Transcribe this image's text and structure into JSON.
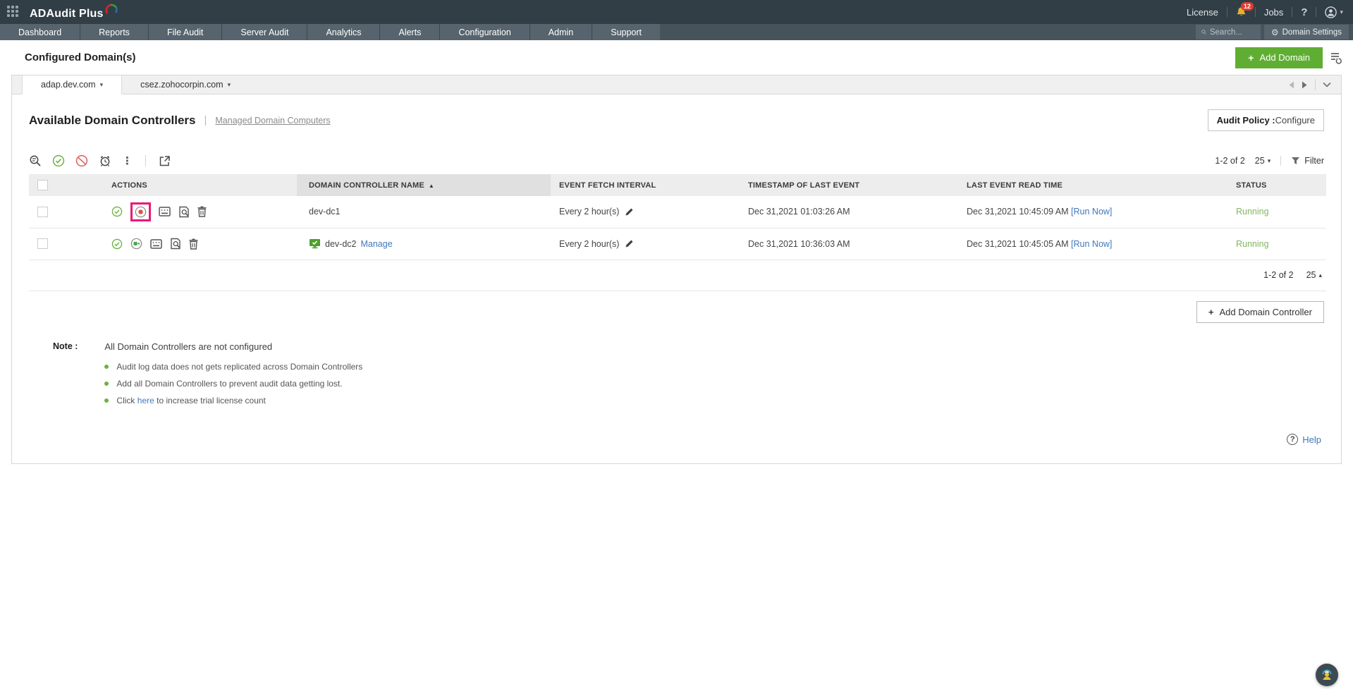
{
  "header": {
    "product_name": "ADAudit Plus",
    "license": "License",
    "notification_count": "12",
    "jobs": "Jobs",
    "help_symbol": "?"
  },
  "nav": {
    "tabs": [
      "Dashboard",
      "Reports",
      "File Audit",
      "Server Audit",
      "Analytics",
      "Alerts",
      "Configuration",
      "Admin",
      "Support"
    ],
    "search_placeholder": "Search...",
    "domain_settings": "Domain Settings"
  },
  "page": {
    "title": "Configured Domain(s)",
    "add_domain_button": "Add Domain"
  },
  "domain_tabs": {
    "active": "adap.dev.com",
    "second": "csez.zohocorpin.com"
  },
  "section": {
    "title": "Available Domain Controllers",
    "managed_link": "Managed Domain Computers",
    "audit_policy_bold": "Audit Policy :",
    "audit_policy_action": "Configure"
  },
  "toolbar": {
    "range": "1-2 of 2",
    "page_size": "25",
    "filter_label": "Filter"
  },
  "table": {
    "headers": {
      "actions": "ACTIONS",
      "dc_name": "DOMAIN CONTROLLER NAME",
      "fetch_interval": "EVENT FETCH INTERVAL",
      "last_event": "TIMESTAMP OF LAST EVENT",
      "last_read": "LAST EVENT READ TIME",
      "status": "STATUS"
    },
    "rows": [
      {
        "name": "dev-dc1",
        "interval": "Every 2 hour(s)",
        "last_event": "Dec 31,2021 01:03:26 AM",
        "last_read": "Dec 31,2021 10:45:09 AM",
        "run_now": "[Run Now]",
        "status": "Running"
      },
      {
        "name": "dev-dc2",
        "manage": "Manage",
        "interval": "Every 2 hour(s)",
        "last_event": "Dec 31,2021 10:36:03 AM",
        "last_read": "Dec 31,2021 10:45:05 AM",
        "run_now": "[Run Now]",
        "status": "Running"
      }
    ],
    "footer_range": "1-2 of 2",
    "footer_page_size": "25"
  },
  "add_dc_button": "Add Domain Controller",
  "note": {
    "label": "Note :",
    "title": "All Domain Controllers are not configured",
    "bullets": [
      {
        "text": "Audit log data does not gets replicated across Domain Controllers"
      },
      {
        "text": "Add all Domain Controllers to prevent audit data getting lost."
      },
      {
        "prefix": "Click ",
        "link": "here",
        "suffix": " to increase trial license count"
      }
    ]
  },
  "help_label": "Help",
  "icons": {
    "plus": "+",
    "caret_down": "▾",
    "caret_up": "▴",
    "sort_asc": "▲",
    "kebab": "⋮",
    "gear": "⚙"
  },
  "colors": {
    "accent_green": "#5fae33",
    "link_blue": "#4077bc",
    "status_running": "#82b860",
    "highlight_pink": "#ec1879"
  }
}
